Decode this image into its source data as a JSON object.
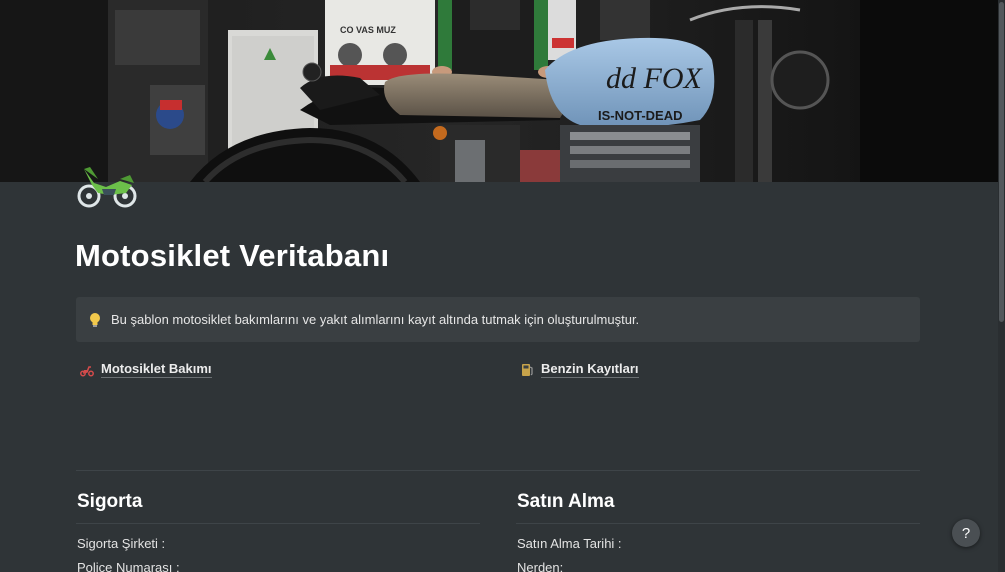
{
  "page": {
    "title": "Motosiklet Veritabanı",
    "icon": "motorcycle-icon",
    "cover": "motorcycle-cover-image"
  },
  "cover_image": {
    "tank_text_top": "dd FOX",
    "tank_text_bottom": "IS-NOT-DEAD",
    "poster_text": "CO VAS MUZ"
  },
  "callout": {
    "icon": "lightbulb-icon",
    "text": "Bu şablon motosiklet bakımlarını ve yakıt alımlarını kayıt altında tutmak için oluşturulmuştur."
  },
  "links": [
    {
      "icon": "scooter-icon",
      "label": "Motosiklet Bakımı"
    },
    {
      "icon": "fuel-pump-icon",
      "label": "Benzin Kayıtları"
    }
  ],
  "sections": {
    "insurance": {
      "title": "Sigorta",
      "fields": [
        "Sigorta Şirketi :",
        "Police Numarası :"
      ]
    },
    "purchase": {
      "title": "Satın Alma",
      "fields": [
        "Satın Alma Tarihi :",
        "Nerden:"
      ]
    }
  },
  "help": {
    "label": "?"
  },
  "colors": {
    "background": "#2f3437",
    "callout_bg": "#3a3f42",
    "tank_blue": "#8fb3d6",
    "icon_green": "#6cc04a"
  }
}
